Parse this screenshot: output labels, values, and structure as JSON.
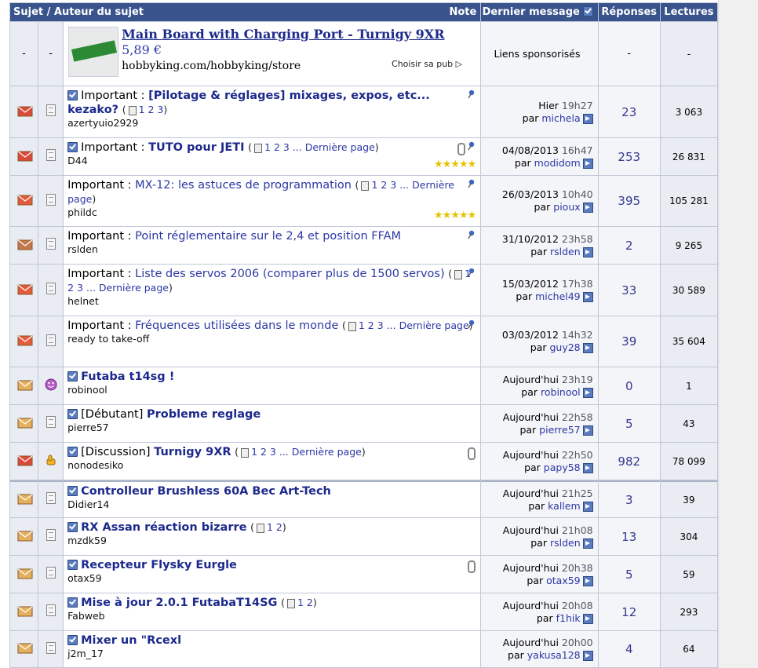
{
  "header": {
    "subject": "Sujet / Auteur du sujet",
    "note": "Note",
    "last": "Dernier message",
    "replies": "Réponses",
    "views": "Lectures"
  },
  "ad": {
    "dash1": "-",
    "dash2": "-",
    "title": "Main Board with Charging Port - Turnigy 9XR",
    "price": "5,89 €",
    "url": "hobbyking.com/hobbyking/store",
    "choice": "Choisir sa pub ▷",
    "sponsor": "Liens sponsorisés",
    "rep": "-",
    "views": "-"
  },
  "topics": [
    {
      "prefix": "Important :",
      "title": "[Pilotage & réglages] mixages, expos, etc... kezako?",
      "pages": "1 2 3",
      "last_page": "",
      "author": "azertyuio2929",
      "date": "Hier",
      "time": "19h27",
      "by": "par",
      "user": "michela",
      "replies": "23",
      "views": "3 063"
    },
    {
      "prefix": "Important :",
      "title": "TUTO pour JETI",
      "pages": "1 2 3 ...",
      "last_page": "Dernière page",
      "author": "D44",
      "date": "04/08/2013",
      "time": "16h47",
      "by": "par",
      "user": "modidom",
      "replies": "253",
      "views": "26 831"
    },
    {
      "prefix": "Important :",
      "title": "MX-12: les astuces de programmation",
      "pages": "1 2 3 ...",
      "last_page": "Dernière page",
      "author": "phildc",
      "date": "26/03/2013",
      "time": "10h40",
      "by": "par",
      "user": "pioux",
      "replies": "395",
      "views": "105 281"
    },
    {
      "prefix": "Important :",
      "title": "Point réglementaire sur le 2,4 et position FFAM",
      "pages": "",
      "last_page": "",
      "author": "rslden",
      "date": "31/10/2012",
      "time": "23h58",
      "by": "par",
      "user": "rslden",
      "replies": "2",
      "views": "9 265"
    },
    {
      "prefix": "Important :",
      "title": "Liste des servos 2006 (comparer plus de 1500 servos)",
      "pages": "1 2 3 ...",
      "last_page": "Dernière page",
      "author": "helnet",
      "date": "15/03/2012",
      "time": "17h38",
      "by": "par",
      "user": "michel49",
      "replies": "33",
      "views": "30 589"
    },
    {
      "prefix": "Important :",
      "title": "Fréquences utilisées dans le monde",
      "pages": "1 2 3 ...",
      "last_page": "Dernière page",
      "author": "ready to take-off",
      "date": "03/03/2012",
      "time": "14h32",
      "by": "par",
      "user": "guy28",
      "replies": "39",
      "views": "35 604"
    },
    {
      "prefix": "",
      "title": "Futaba t14sg !",
      "pages": "",
      "last_page": "",
      "author": "robinool",
      "date": "Aujourd'hui",
      "time": "23h19",
      "by": "par",
      "user": "robinool",
      "replies": "0",
      "views": "1"
    },
    {
      "prefix": "[Débutant]",
      "title": "Probleme reglage",
      "pages": "",
      "last_page": "",
      "author": "pierre57",
      "date": "Aujourd'hui",
      "time": "22h58",
      "by": "par",
      "user": "pierre57",
      "replies": "5",
      "views": "43"
    },
    {
      "prefix": "[Discussion]",
      "title": "Turnigy 9XR",
      "pages": "1 2 3 ...",
      "last_page": "Dernière page",
      "author": "nonodesiko",
      "date": "Aujourd'hui",
      "time": "22h50",
      "by": "par",
      "user": "papy58",
      "replies": "982",
      "views": "78 099"
    },
    {
      "prefix": "",
      "title": "Controlleur Brushless 60A Bec Art-Tech",
      "pages": "",
      "last_page": "",
      "author": "Didier14",
      "date": "Aujourd'hui",
      "time": "21h25",
      "by": "par",
      "user": "kallem",
      "replies": "3",
      "views": "39"
    },
    {
      "prefix": "",
      "title": "RX Assan réaction bizarre",
      "pages": "1 2",
      "last_page": "",
      "author": "mzdk59",
      "date": "Aujourd'hui",
      "time": "21h08",
      "by": "par",
      "user": "rslden",
      "replies": "13",
      "views": "304"
    },
    {
      "prefix": "",
      "title": "Recepteur Flysky Eurgle",
      "pages": "",
      "last_page": "",
      "author": "otax59",
      "date": "Aujourd'hui",
      "time": "20h38",
      "by": "par",
      "user": "otax59",
      "replies": "5",
      "views": "59"
    },
    {
      "prefix": "",
      "title": "Mise à jour 2.0.1 FutabaT14SG",
      "pages": "1 2",
      "last_page": "",
      "author": "Fabweb",
      "date": "Aujourd'hui",
      "time": "20h08",
      "by": "par",
      "user": "f1hik",
      "replies": "12",
      "views": "293"
    },
    {
      "prefix": "",
      "title": "Mixer un \"Rcexl",
      "pages": "",
      "last_page": "",
      "author": "j2m_17",
      "date": "Aujourd'hui",
      "time": "20h00",
      "by": "par",
      "user": "yakusa128",
      "replies": "4",
      "views": "64"
    }
  ],
  "stars": "★★★★★"
}
